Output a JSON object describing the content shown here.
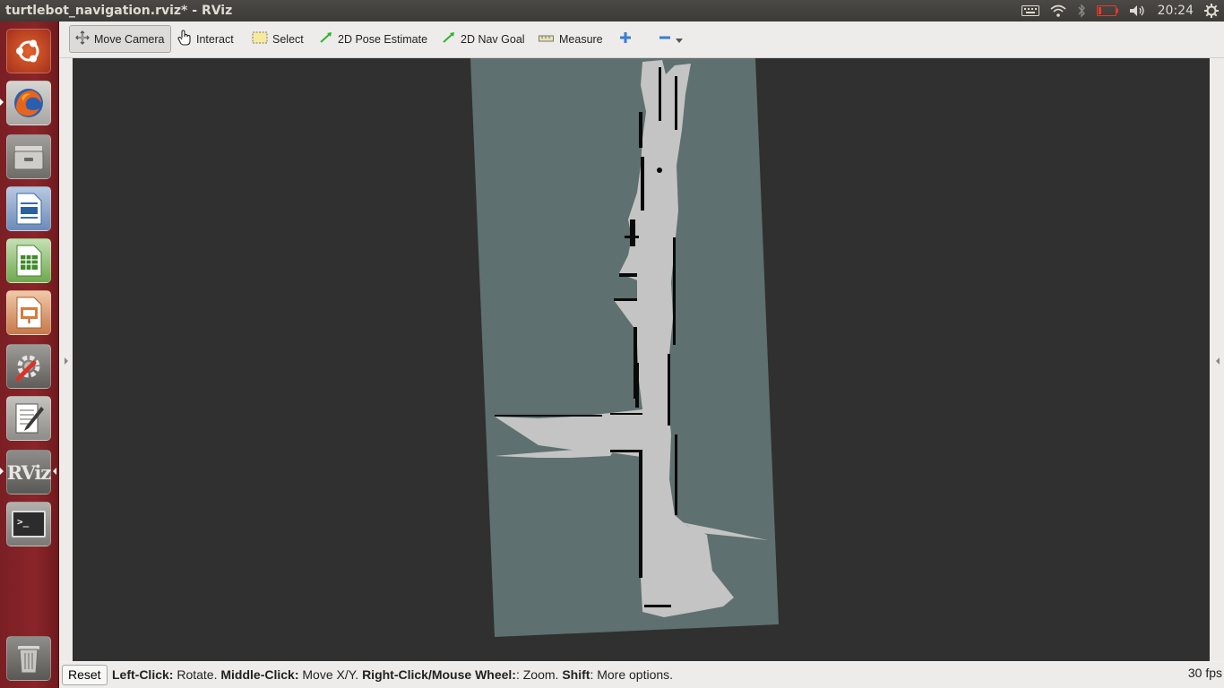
{
  "window": {
    "title": "turtlebot_navigation.rviz* - RViz"
  },
  "tray": {
    "clock": "20:24"
  },
  "launcher": {
    "items": [
      {
        "name": "ubuntu-dash-icon"
      },
      {
        "name": "firefox-icon"
      },
      {
        "name": "files-icon"
      },
      {
        "name": "libreoffice-writer-icon"
      },
      {
        "name": "libreoffice-calc-icon"
      },
      {
        "name": "libreoffice-impress-icon"
      },
      {
        "name": "system-settings-icon"
      },
      {
        "name": "text-editor-icon"
      },
      {
        "name": "rviz-icon",
        "label": "RViz"
      },
      {
        "name": "terminal-icon",
        "label": ">_"
      },
      {
        "name": "trash-icon"
      }
    ]
  },
  "toolbar": {
    "move_camera": "Move Camera",
    "interact": "Interact",
    "select": "Select",
    "pose_estimate": "2D Pose Estimate",
    "nav_goal": "2D Nav Goal",
    "measure": "Measure"
  },
  "status": {
    "reset": "Reset",
    "left_click_key": "Left-Click:",
    "left_click_val": " Rotate. ",
    "middle_click_key": "Middle-Click:",
    "middle_click_val": " Move X/Y. ",
    "right_click_key": "Right-Click/Mouse Wheel:",
    "right_click_val": ": Zoom. ",
    "shift_key": "Shift",
    "shift_val": ": More options.",
    "fps": "30 fps"
  },
  "colors": {
    "map_unknown": "#5e706f",
    "map_free": "#c4c4c4",
    "map_occupied": "#0a0a0a",
    "viewport_bg": "#303030"
  }
}
